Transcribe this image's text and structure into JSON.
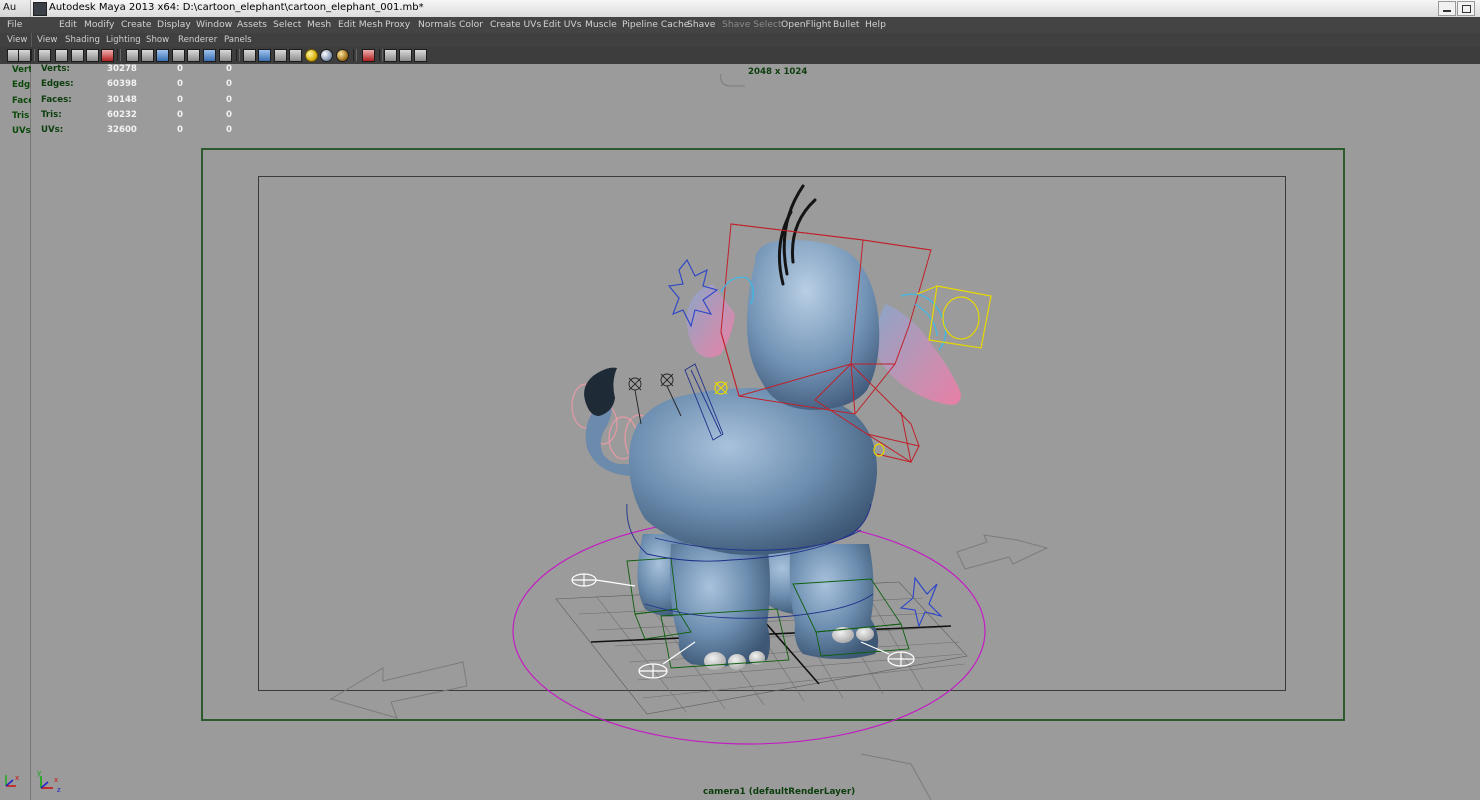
{
  "window": {
    "short_title": "Au",
    "title": "Autodesk Maya 2013 x64: D:\\cartoon_elephant\\cartoon_elephant_001.mb*"
  },
  "menubar": {
    "items": [
      "File",
      "Edit",
      "Modify",
      "Create",
      "Display",
      "Window",
      "Assets",
      "Select",
      "Mesh",
      "Edit Mesh",
      "Proxy",
      "Normals",
      "Color",
      "Create UVs",
      "Edit UVs",
      "Muscle",
      "Pipeline Cache",
      "Shave",
      "Shave Select",
      "OpenFlight",
      "Bullet",
      "Help"
    ],
    "disabled": [
      "Shave Select"
    ]
  },
  "panel_menu": {
    "left_label": "View",
    "items": [
      "View",
      "Shading",
      "Lighting",
      "Show",
      "Renderer",
      "Panels"
    ]
  },
  "left_strip": {
    "labels": [
      "Vert",
      "Edg",
      "Face",
      "Tris",
      "UVs"
    ]
  },
  "hud": {
    "rows": [
      {
        "label": "Verts:",
        "value": "30278",
        "c1": "0",
        "c2": "0"
      },
      {
        "label": "Edges:",
        "value": "60398",
        "c1": "0",
        "c2": "0"
      },
      {
        "label": "Faces:",
        "value": "30148",
        "c1": "0",
        "c2": "0"
      },
      {
        "label": "Tris:",
        "value": "60232",
        "c1": "0",
        "c2": "0"
      },
      {
        "label": "UVs:",
        "value": "32600",
        "c1": "0",
        "c2": "0"
      }
    ]
  },
  "viewport": {
    "resolution": "2048 x 1024",
    "camera": "camera1 (defaultRenderLayer)",
    "axis_labels": [
      "x",
      "y",
      "z"
    ]
  },
  "colors": {
    "menubar_bg": "#444444",
    "viewport_bg": "#9b9b9b",
    "resolution_gate": "#2c5a2c",
    "control_red": "#c0202a",
    "control_yellow": "#e8d800",
    "control_cyan": "#3fb8e6",
    "control_pink": "#e89aa6",
    "ground_circle": "#c21ec2",
    "elephant_body": "#6e8fb0"
  }
}
